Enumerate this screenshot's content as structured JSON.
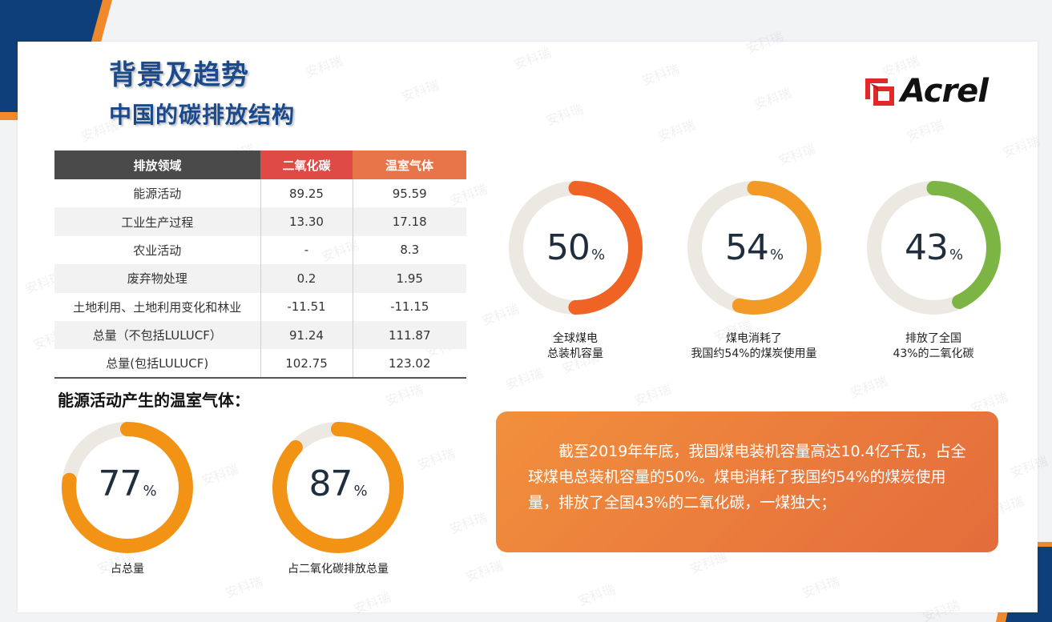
{
  "header": {
    "title": "背景及趋势",
    "subtitle": "中国的碳排放结构",
    "logo_text": "Acrel"
  },
  "watermark": "安科瑞",
  "table": {
    "columns": [
      "排放领域",
      "二氧化碳",
      "温室气体"
    ],
    "rows": [
      [
        "能源活动",
        "89.25",
        "95.59"
      ],
      [
        "工业生产过程",
        "13.30",
        "17.18"
      ],
      [
        "农业活动",
        "-",
        "8.3"
      ],
      [
        "废弃物处理",
        "0.2",
        "1.95"
      ],
      [
        "土地利用、土地利用变化和林业",
        "-11.51",
        "-11.15"
      ],
      [
        "总量（不包括LULUCF）",
        "91.24",
        "111.87"
      ],
      [
        "总量(包括LULUCF)",
        "102.75",
        "123.02"
      ]
    ]
  },
  "energy_section": {
    "heading": "能源活动产生的温室气体：",
    "rings": [
      {
        "value": "77",
        "fraction": 0.77,
        "unit": "%",
        "caption": [
          "占总量"
        ],
        "color": "#f39316"
      },
      {
        "value": "87",
        "fraction": 0.87,
        "unit": "%",
        "caption": [
          "占二氧化碳排放总量"
        ],
        "color": "#f39316"
      }
    ]
  },
  "coal_rings": [
    {
      "value": "50",
      "fraction": 0.5,
      "unit": "%",
      "caption": [
        "全球煤电",
        "总装机容量"
      ],
      "color": "#ef6424"
    },
    {
      "value": "54",
      "fraction": 0.54,
      "unit": "%",
      "caption": [
        "煤电消耗了",
        "我国约54%的煤炭使用量"
      ],
      "color": "#f39a26"
    },
    {
      "value": "43",
      "fraction": 0.43,
      "unit": "%",
      "caption": [
        "排放了全国",
        "43%的二氧化碳"
      ],
      "color": "#7db545"
    }
  ],
  "summary": {
    "text": "截至2019年年底，我国煤电装机容量高达10.4亿千瓦，占全球煤电总装机容量的50%。煤电消耗了我国约54%的煤炭使用量，排放了全国43%的二氧化碳，一煤独大；"
  },
  "colors": {
    "brand_blue": "#1b4a8c",
    "deco_orange": "#f0892b",
    "track": "#ece8e2",
    "header_gray": "#4a4a4a",
    "header_red": "#e04a45",
    "header_orange": "#e8744a"
  }
}
